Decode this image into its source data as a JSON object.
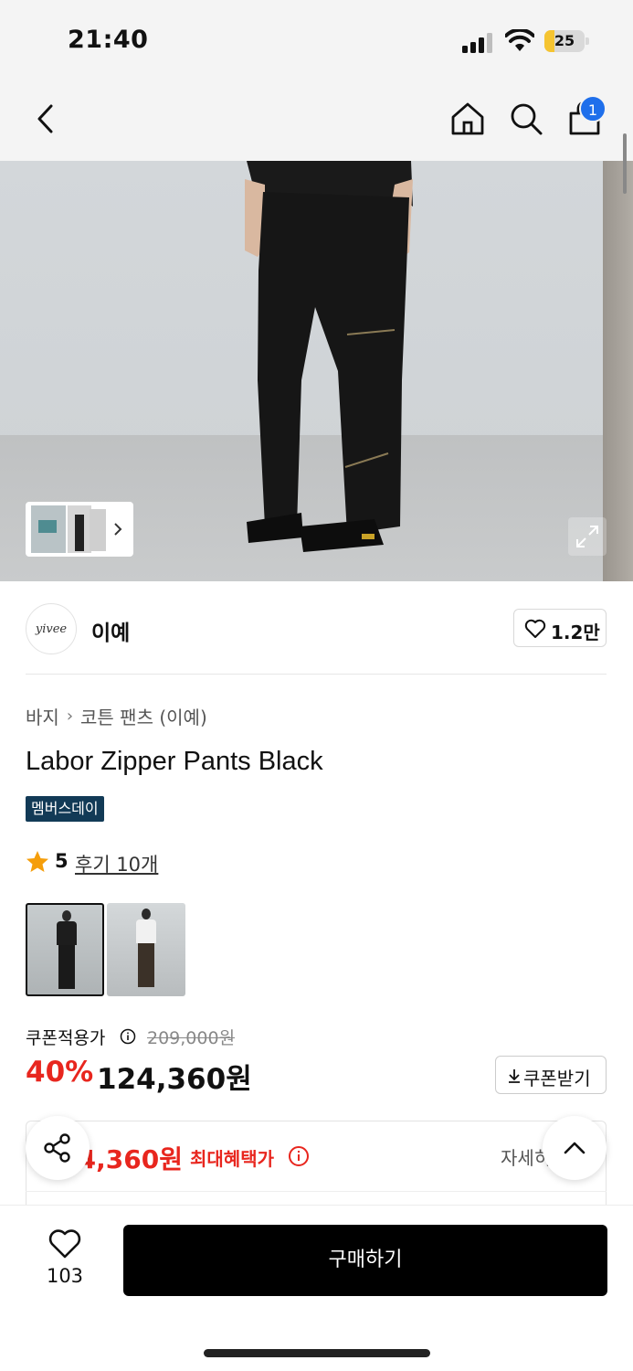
{
  "status_bar": {
    "time": "21:40",
    "battery": "25",
    "battery_level_pct": 25
  },
  "nav": {
    "cart_count": "1",
    "icons": [
      "chevron-left-icon",
      "home-icon",
      "search-icon",
      "bag-icon"
    ]
  },
  "brand": {
    "logo_text": "yivee",
    "name": "이예",
    "likes": "1.2만"
  },
  "product": {
    "breadcrumb": [
      "바지",
      "코튼 팬츠",
      "(이예)"
    ],
    "title": "Labor Zipper Pants Black",
    "badge": "멤버스데이",
    "rating": "5",
    "review_link": "후기 10개"
  },
  "price": {
    "label": "쿠폰적용가",
    "original": "209,000원",
    "discount": "40%",
    "sale": "124,360원",
    "coupon_button": "쿠폰받기"
  },
  "benefit": {
    "price": "124,360원",
    "label": "최대혜택가",
    "detail": "자세히"
  },
  "bottom": {
    "wish_count": "103",
    "buy_button": "구매하기"
  },
  "colors": {
    "accent_red": "#e8261e",
    "badge_navy": "#123a56",
    "cart_badge_blue": "#1f6feb",
    "star_orange": "#f59e0b"
  }
}
